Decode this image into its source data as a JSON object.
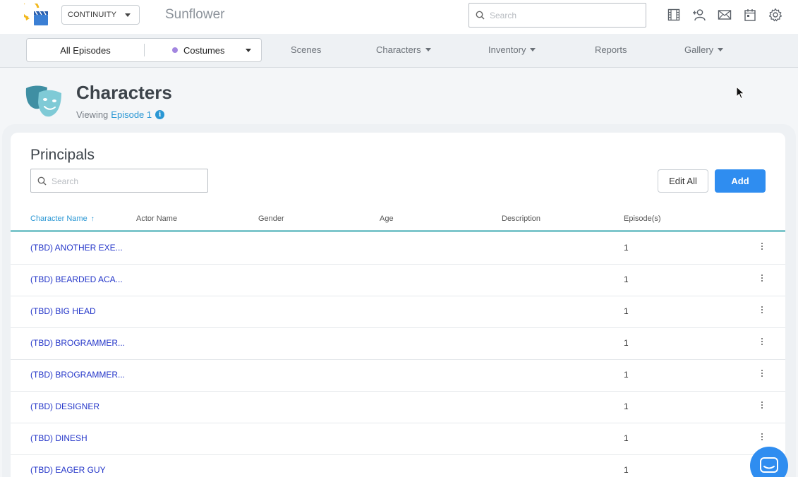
{
  "app": {
    "mode_select": "CONTINUITY",
    "project_name": "Sunflower",
    "search_placeholder": "Search"
  },
  "topbar_icons": [
    "film-icon",
    "add-user-icon",
    "mail-icon",
    "calendar-icon",
    "gear-icon"
  ],
  "navbar": {
    "episode_scope": "All Episodes",
    "department": "Costumes",
    "department_color": "#a386e0",
    "links": [
      {
        "label": "Scenes",
        "dropdown": false
      },
      {
        "label": "Characters",
        "dropdown": true
      },
      {
        "label": "Inventory",
        "dropdown": true
      },
      {
        "label": "Reports",
        "dropdown": false
      },
      {
        "label": "Gallery",
        "dropdown": true
      }
    ]
  },
  "header": {
    "title": "Characters",
    "viewing_prefix": "Viewing",
    "viewing_episode": "Episode 1",
    "info_glyph": "i"
  },
  "principals": {
    "title": "Principals",
    "search_placeholder": "Search",
    "edit_all_label": "Edit All",
    "add_label": "Add",
    "columns": [
      "Character Name",
      "Actor Name",
      "Gender",
      "Age",
      "Description",
      "Episode(s)"
    ],
    "sort_arrow": "↑",
    "rows": [
      {
        "name": "(TBD) ANOTHER EXE...",
        "episodes": "1"
      },
      {
        "name": "(TBD) BEARDED ACA...",
        "episodes": "1"
      },
      {
        "name": "(TBD) BIG HEAD",
        "episodes": "1"
      },
      {
        "name": "(TBD) BROGRAMMER...",
        "episodes": "1"
      },
      {
        "name": "(TBD) BROGRAMMER...",
        "episodes": "1"
      },
      {
        "name": "(TBD) DESIGNER",
        "episodes": "1"
      },
      {
        "name": "(TBD) DINESH",
        "episodes": "1"
      },
      {
        "name": "(TBD) EAGER GUY",
        "episodes": "1"
      }
    ]
  },
  "colors": {
    "accent": "#2f8df0",
    "link": "#2a97d4",
    "row_link": "#2436c9",
    "header_rule": "#7fc7cc",
    "masks": "#4fa3b5"
  }
}
